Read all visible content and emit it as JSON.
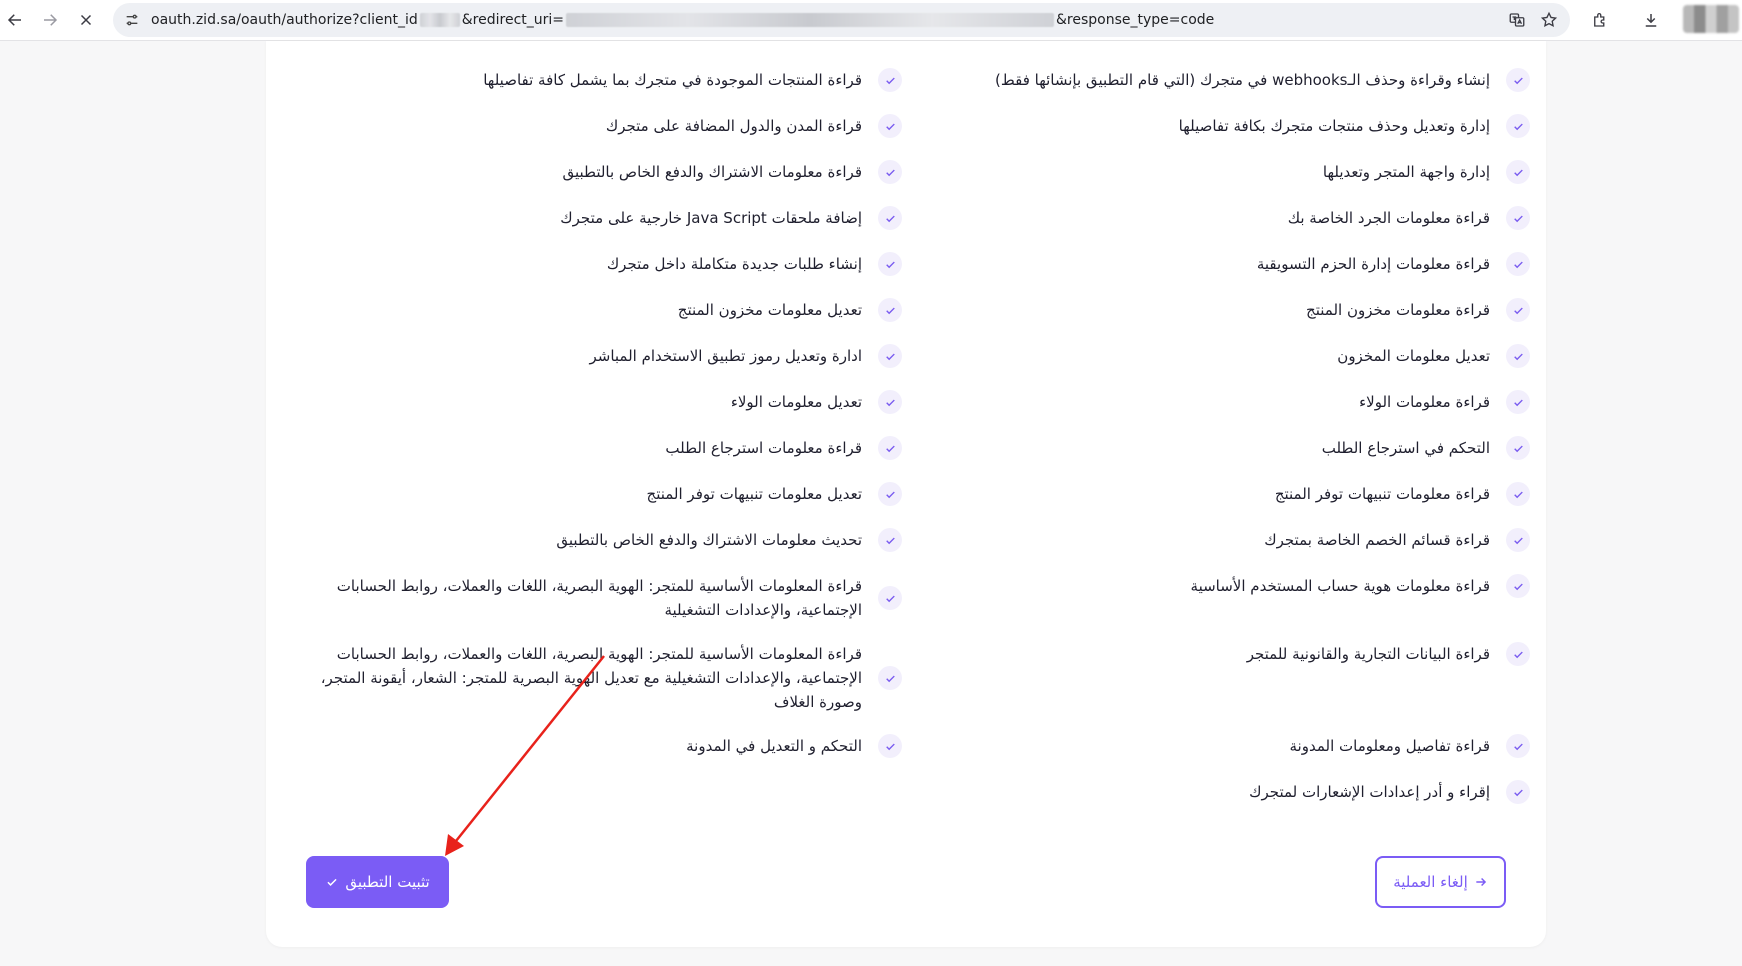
{
  "browser": {
    "url_prefix": "oauth.zid.sa/oauth/authorize?client_id",
    "url_redirect": "&redirect_uri=",
    "url_suffix": "&response_type=code"
  },
  "permissions_right": [
    "إنشاء وقراءة وحذف الـwebhooks في متجرك (التي قام التطبيق بإنشائها فقط)",
    "إدارة وتعديل وحذف منتجات متجرك بكافة تفاصيلها",
    "إدارة واجهة المتجر وتعديلها",
    "قراءة معلومات الجرد الخاصة بك",
    "قراءة معلومات إدارة الحزم التسويقية",
    "قراءة معلومات مخزون المنتج",
    "تعديل معلومات المخزون",
    "قراءة معلومات الولاء",
    "التحكم في استرجاع الطلب",
    "قراءة معلومات تنبيهات توفر المنتج",
    "قراءة قسائم الخصم الخاصة بمتجرك",
    "قراءة معلومات هوية حساب المستخدم الأساسية",
    "قراءة البيانات التجارية والقانونية للمتجر",
    "قراءة تفاصيل ومعلومات المدونة",
    "إقراء و أدر إعدادات الإشعارات لمتجرك"
  ],
  "permissions_left": [
    "قراءة المنتجات الموجودة في متجرك بما يشمل كافة تفاصيلها",
    "قراءة المدن والدول المضافة على متجرك",
    "قراءة معلومات الاشتراك والدفع الخاص بالتطبيق",
    "إضافة ملحقات Java Script خارجية على متجرك",
    "إنشاء طلبات جديدة متكاملة داخل متجرك",
    "تعديل معلومات مخزون المنتج",
    "ادارة وتعديل رموز تطبيق الاستخدام المباشر",
    "تعديل معلومات الولاء",
    "قراءة معلومات استرجاع الطلب",
    "تعديل معلومات تنبيهات توفر المنتج",
    "تحديث معلومات الاشتراك والدفع الخاص بالتطبيق",
    "قراءة المعلومات الأساسية للمتجر: الهوية البصرية، اللغات والعملات، روابط الحسابات الإجتماعية، والإعدادات التشغيلية",
    "قراءة المعلومات الأساسية للمتجر: الهوية البصرية، اللغات والعملات، روابط الحسابات الإجتماعية، والإعدادات التشغيلية مع تعديل الهوية البصرية للمتجر: الشعار، أيقونة المتجر، وصورة الغلاف",
    "التحكم و التعديل في المدونة"
  ],
  "permissions_left_lines": [
    [
      "قراءة المعلومات الأساسية للمتجر: الهوية البصرية، اللغات والعملات، روابط الحسابات",
      "الإجتماعية، والإعدادات التشغيلية"
    ],
    [
      "قراءة المعلومات الأساسية للمتجر: الهوية البصرية، اللغات والعملات، روابط الحسابات",
      "الإجتماعية، والإعدادات التشغيلية مع تعديل الهوية البصرية للمتجر: الشعار، أيقونة المتجر،",
      "وصورة الغلاف"
    ]
  ],
  "actions": {
    "install_label": "تثبيت التطبيق",
    "cancel_label": "إلغاء العملية"
  },
  "colors": {
    "accent": "#7b5cf5",
    "check_bg": "#f2effc",
    "annotation": "#e8221b"
  }
}
